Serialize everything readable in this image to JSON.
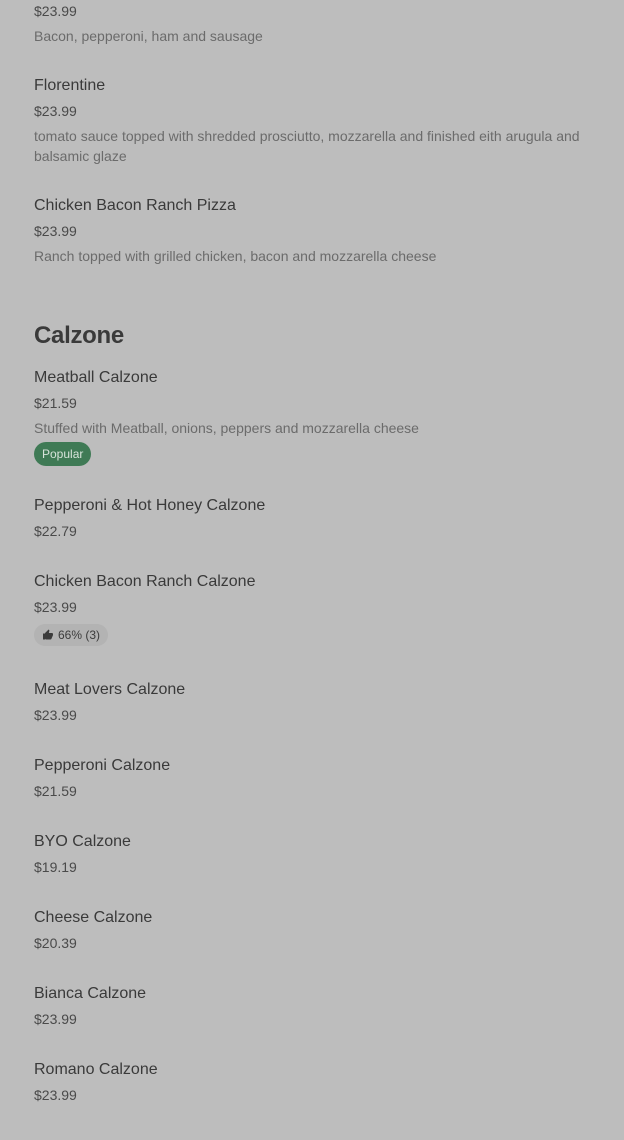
{
  "prev_items": [
    {
      "price": "$23.99",
      "description": "Bacon, pepperoni, ham and sausage"
    },
    {
      "name": "Florentine",
      "price": "$23.99",
      "description": "tomato sauce topped with shredded prosciutto, mozzarella and finished eith arugula and balsamic glaze"
    },
    {
      "name": "Chicken Bacon Ranch Pizza",
      "price": "$23.99",
      "description": "Ranch topped with grilled chicken, bacon and mozzarella cheese"
    }
  ],
  "calzone_section": {
    "title": "Calzone",
    "items": [
      {
        "name": "Meatball Calzone",
        "price": "$21.59",
        "description": "Stuffed with Meatball, onions, peppers and mozzarella cheese",
        "badge": "Popular"
      },
      {
        "name": "Pepperoni & Hot Honey Calzone",
        "price": "$22.79"
      },
      {
        "name": "Chicken Bacon Ranch Calzone",
        "price": "$23.99",
        "rating": "66% (3)"
      },
      {
        "name": "Meat Lovers Calzone",
        "price": "$23.99"
      },
      {
        "name": "Pepperoni Calzone",
        "price": "$21.59"
      },
      {
        "name": "BYO Calzone",
        "price": "$19.19"
      },
      {
        "name": "Cheese Calzone",
        "price": "$20.39"
      },
      {
        "name": "Bianca Calzone",
        "price": "$23.99"
      },
      {
        "name": "Romano Calzone",
        "price": "$23.99"
      }
    ]
  },
  "colors": {
    "background": "#bdbdbd",
    "popular_badge": "#3f7a55"
  }
}
